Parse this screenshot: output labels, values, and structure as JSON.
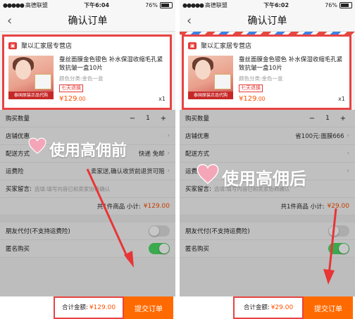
{
  "status": {
    "carrier": "高德联盟",
    "battery": "76%"
  },
  "screens": [
    {
      "time": "下午6:04",
      "title": "确认订单",
      "shop": "聚以汇家居专营店",
      "product": {
        "name": "蚕丝面膜金色银色 补水保湿收缩毛孔紧致抗皱一盒10片",
        "spec": "颜色分类:金色一盒",
        "tag": "七天退换",
        "price": "¥129",
        "price_dec": ".00",
        "qty": "x1",
        "thumb_badge": "泰国原装正品代购"
      },
      "rows": {
        "quantity_label": "购买数量",
        "quantity": "1",
        "discount_label": "店铺优惠",
        "discount_value": "",
        "delivery_label": "配送方式",
        "delivery_value": "快递 免邮",
        "insurance_label": "运费险",
        "insurance_value": "卖家送,确认收货前退货可赔",
        "message_label": "买家留言:",
        "message_placeholder": "选填:填写内容已和卖家协商确认",
        "total_label": "共1件商品  小计:",
        "total_value": "¥129.00",
        "friend_pay_label": "朋友代付(不支持运费险)",
        "anonymous_label": "匿名购买"
      },
      "bottom": {
        "sum_label": "合计金额:",
        "sum_value": "¥129.00",
        "submit": "提交订单"
      },
      "caption": "使用高佣前"
    },
    {
      "time": "下午6:02",
      "title": "确认订单",
      "shop": "聚以汇家居专营店",
      "product": {
        "name": "蚕丝面膜金色银色 补水保湿收缩毛孔紧致抗皱一盒10片",
        "spec": "颜色分类:金色一盒",
        "tag": "七天退换",
        "price": "¥129",
        "price_dec": ".00",
        "qty": "x1",
        "thumb_badge": "泰国原装正品代购"
      },
      "rows": {
        "quantity_label": "购买数量",
        "quantity": "1",
        "discount_label": "店铺优惠",
        "discount_value": "省100元:面膜666",
        "delivery_label": "配送方式",
        "delivery_value": "",
        "insurance_label": "运费险",
        "insurance_value": "",
        "message_label": "买家留言:",
        "message_placeholder": "选填:填写内容已和卖家协商确认",
        "total_label": "共1件商品  小计:",
        "total_value": "¥29.00",
        "friend_pay_label": "朋友代付(不支持运费险)",
        "anonymous_label": "匿名购买"
      },
      "bottom": {
        "sum_label": "合计金额:",
        "sum_value": "¥29.00",
        "submit": "提交订单"
      },
      "caption": "使用高佣后"
    }
  ]
}
